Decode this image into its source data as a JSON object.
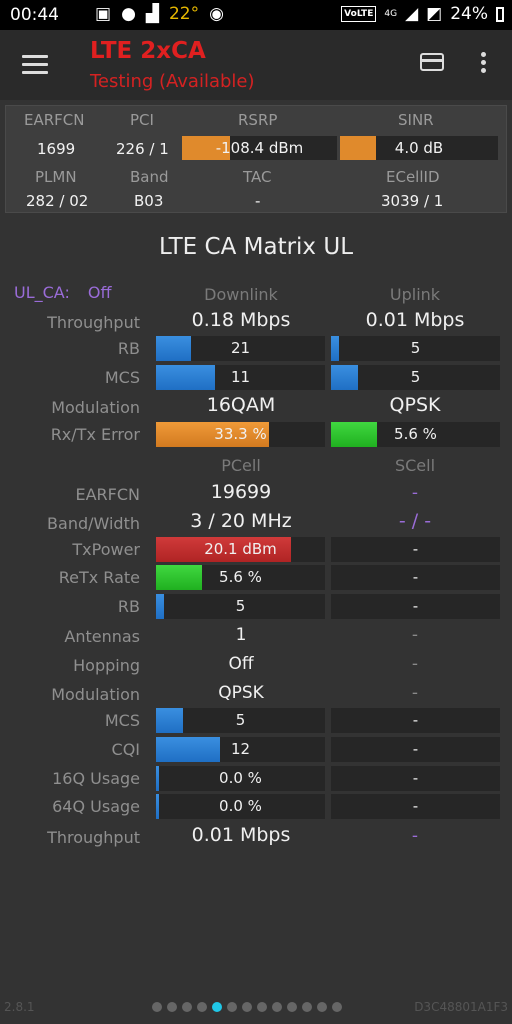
{
  "status_bar": {
    "time": "00:44",
    "temperature": "22°",
    "volte": "VoLTE",
    "network": "4G",
    "battery": "24%"
  },
  "app_bar": {
    "title": "LTE 2xCA",
    "subtitle": "Testing (Available)"
  },
  "info": {
    "labels": [
      "EARFCN",
      "PCI",
      "RSRP",
      "SINR",
      "PLMN",
      "Band",
      "TAC",
      "ECellID"
    ],
    "earfcn": "1699",
    "pci": "226 / 1",
    "rsrp": "-108.4 dBm",
    "rsrp_fill": 0.31,
    "sinr": "4.0 dB",
    "sinr_fill": 0.23,
    "plmn": "282 / 02",
    "band": "B03",
    "tac": "-",
    "ecellid": "3039 / 1"
  },
  "section_title": "LTE CA Matrix UL",
  "ul_ca": {
    "label": "UL_CA:",
    "value": "Off"
  },
  "headers": {
    "downlink": "Downlink",
    "uplink": "Uplink",
    "pcell": "PCell",
    "scell": "SCell"
  },
  "top_rows": {
    "throughput": {
      "label": "Throughput",
      "dl": "0.18 Mbps",
      "ul": "0.01 Mbps"
    },
    "rb": {
      "label": "RB",
      "dl": "21",
      "dl_fill": 0.21,
      "ul": "5",
      "ul_fill": 0.05
    },
    "mcs": {
      "label": "MCS",
      "dl": "11",
      "dl_fill": 0.35,
      "ul": "5",
      "ul_fill": 0.16
    },
    "modulation": {
      "label": "Modulation",
      "dl": "16QAM",
      "ul": "QPSK"
    },
    "rxtx_error": {
      "label": "Rx/Tx Error",
      "dl": "33.3 %",
      "dl_fill": 0.67,
      "ul": "5.6 %",
      "ul_fill": 0.27
    }
  },
  "cell_rows": {
    "earfcn": {
      "label": "EARFCN",
      "p": "19699",
      "s": "-"
    },
    "band_width": {
      "label": "Band/Width",
      "p": "3 / 20 MHz",
      "s": "- / -"
    },
    "txpower": {
      "label": "TxPower",
      "p": "20.1 dBm",
      "p_fill": 0.8,
      "s": "-"
    },
    "retx_rate": {
      "label": "ReTx Rate",
      "p": "5.6 %",
      "p_fill": 0.27,
      "s": "-"
    },
    "rb": {
      "label": "RB",
      "p": "5",
      "p_fill": 0.05,
      "s": "-"
    },
    "antennas": {
      "label": "Antennas",
      "p": "1",
      "s": "-"
    },
    "hopping": {
      "label": "Hopping",
      "p": "Off",
      "s": "-"
    },
    "modulation": {
      "label": "Modulation",
      "p": "QPSK",
      "s": "-"
    },
    "mcs": {
      "label": "MCS",
      "p": "5",
      "p_fill": 0.16,
      "s": "-"
    },
    "cqi": {
      "label": "CQI",
      "p": "12",
      "p_fill": 0.38,
      "s": "-"
    },
    "usage_16q": {
      "label": "16Q Usage",
      "p": "0.0 %",
      "p_fill": 0.02,
      "s": "-"
    },
    "usage_64q": {
      "label": "64Q Usage",
      "p": "0.0 %",
      "p_fill": 0.02,
      "s": "-"
    },
    "throughput": {
      "label": "Throughput",
      "p": "0.01 Mbps",
      "s": "-"
    }
  },
  "footer": {
    "version": "2.8.1",
    "page_count": 13,
    "active_page": 4,
    "cell_id": "D3C48801A1F3"
  }
}
